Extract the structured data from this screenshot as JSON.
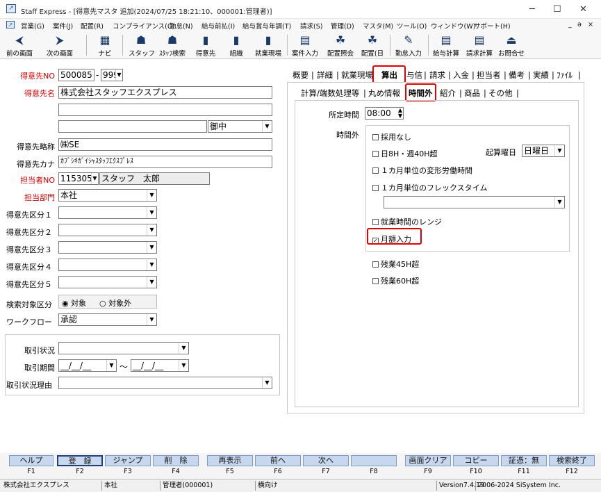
{
  "window": {
    "title": "Staff Express - [得意先マスタ 追加(2024/07/25 18:21:10、000001:管理者)]",
    "min": "─",
    "max": "☐",
    "close": "✕"
  },
  "menu": [
    "営業(G)",
    "案件(J)",
    "配置(R)",
    "コンプライアンス(C)",
    "勤怠(N)",
    "給与前払(I)",
    "給与賞与年調(T)",
    "請求(S)",
    "管理(D)",
    "マスタ(M)",
    "ツール(O)",
    "ウィンドウ(W)",
    "サポート(H)"
  ],
  "mdi": {
    "min": "_",
    "restore": "ǝ",
    "close": "×"
  },
  "toolbar": [
    {
      "label": "前の画面",
      "icon": "⮜"
    },
    {
      "label": "次の画面",
      "icon": "⮞"
    },
    {
      "label": "ナビ",
      "icon": "▦"
    },
    {
      "label": "スタッフ",
      "icon": "☗"
    },
    {
      "label": "ｽﾀｯﾌ検索",
      "icon": "☗"
    },
    {
      "label": "得意先",
      "icon": "▮"
    },
    {
      "label": "組織",
      "icon": "▮"
    },
    {
      "label": "就業現場",
      "icon": "▮"
    },
    {
      "label": "案件入力",
      "icon": "▤"
    },
    {
      "label": "配置照会",
      "icon": "☘"
    },
    {
      "label": "配置(日",
      "icon": "☘"
    },
    {
      "label": "勤怠入力",
      "icon": "✎"
    },
    {
      "label": "給与計算",
      "icon": "▤"
    },
    {
      "label": "請求計算",
      "icon": "▤"
    },
    {
      "label": "お問合せ",
      "icon": "⏏"
    }
  ],
  "form": {
    "cust_no_label": "得意先NO",
    "cust_no": "500085",
    "cust_no_sep": "-",
    "cust_sub": "999",
    "name_label": "得意先名",
    "name1": "株式会社スタッフエクスプレス",
    "name2": "",
    "name3": "",
    "honorific": "御中",
    "short_label": "得意先略称",
    "short": "㈱SE",
    "kana_label": "得意先カナ",
    "kana": "ｶﾌﾞｼｷｶﾞｲｼｬｽﾀｯﾌｴｸｽﾌﾟﾚｽ",
    "staff_label": "担当者NO",
    "staff_no": "115305",
    "staff_name": "スタッフ　太郎",
    "dept_label": "担当部門",
    "dept": "本社",
    "cls1_label": "得意先区分１",
    "cls2_label": "得意先区分２",
    "cls3_label": "得意先区分３",
    "cls4_label": "得意先区分４",
    "cls5_label": "得意先区分５",
    "search_label": "検索対象区分",
    "search_on": "対象",
    "search_off": "対象外",
    "workflow_label": "ワークフロー",
    "workflow": "承認",
    "trade_status_label": "取引状況",
    "trade_period_label": "取引期間",
    "date_from": "__/__/__",
    "date_to": "__/__/__",
    "tilde": "～",
    "trade_reason_label": "取引状況理由"
  },
  "tabs1": [
    "概要",
    "詳細",
    "就業現場",
    "算出",
    "与信",
    "請求",
    "入金",
    "担当者",
    "備考",
    "実績",
    "ﾌｧｲﾙ"
  ],
  "tabs2": [
    "計算/端数処理等",
    "丸め情報",
    "時間外",
    "紹介",
    "商品",
    "その他"
  ],
  "panel": {
    "fixed_label": "所定時間",
    "fixed_time": "08:00",
    "ot_label": "時間外",
    "c1": "採用なし",
    "c2": "日8H・週40H超",
    "start_label": "起算曜日",
    "start_day": "日曜日",
    "c3": "１カ月単位の変形労働時間",
    "c4": "１カ月単位のフレックスタイム",
    "c5": "就業時間のレンジ",
    "c6": "月額入力",
    "c7": "残業45H超",
    "c8": "残業60H超"
  },
  "fkeys": [
    {
      "label": "ヘルプ",
      "key": "F1"
    },
    {
      "label": "登　録",
      "key": "F2"
    },
    {
      "label": "ジャンプ",
      "key": "F3"
    },
    {
      "label": "削　除",
      "key": "F4"
    },
    {
      "label": "再表示",
      "key": "F5"
    },
    {
      "label": "前へ",
      "key": "F6"
    },
    {
      "label": "次へ",
      "key": "F7"
    },
    {
      "label": "",
      "key": "F8"
    },
    {
      "label": "画面クリア",
      "key": "F9"
    },
    {
      "label": "コピー",
      "key": "F10"
    },
    {
      "label": "証憑：無",
      "key": "F11"
    },
    {
      "label": "検索終了",
      "key": "F12"
    }
  ],
  "status": {
    "company": "株式会社エクスプレス",
    "office": "本社",
    "user": "管理者(000001)",
    "mode": "横向け",
    "version": "Version7.4.19",
    "copyright": "2006-2024 SiSystem Inc."
  }
}
